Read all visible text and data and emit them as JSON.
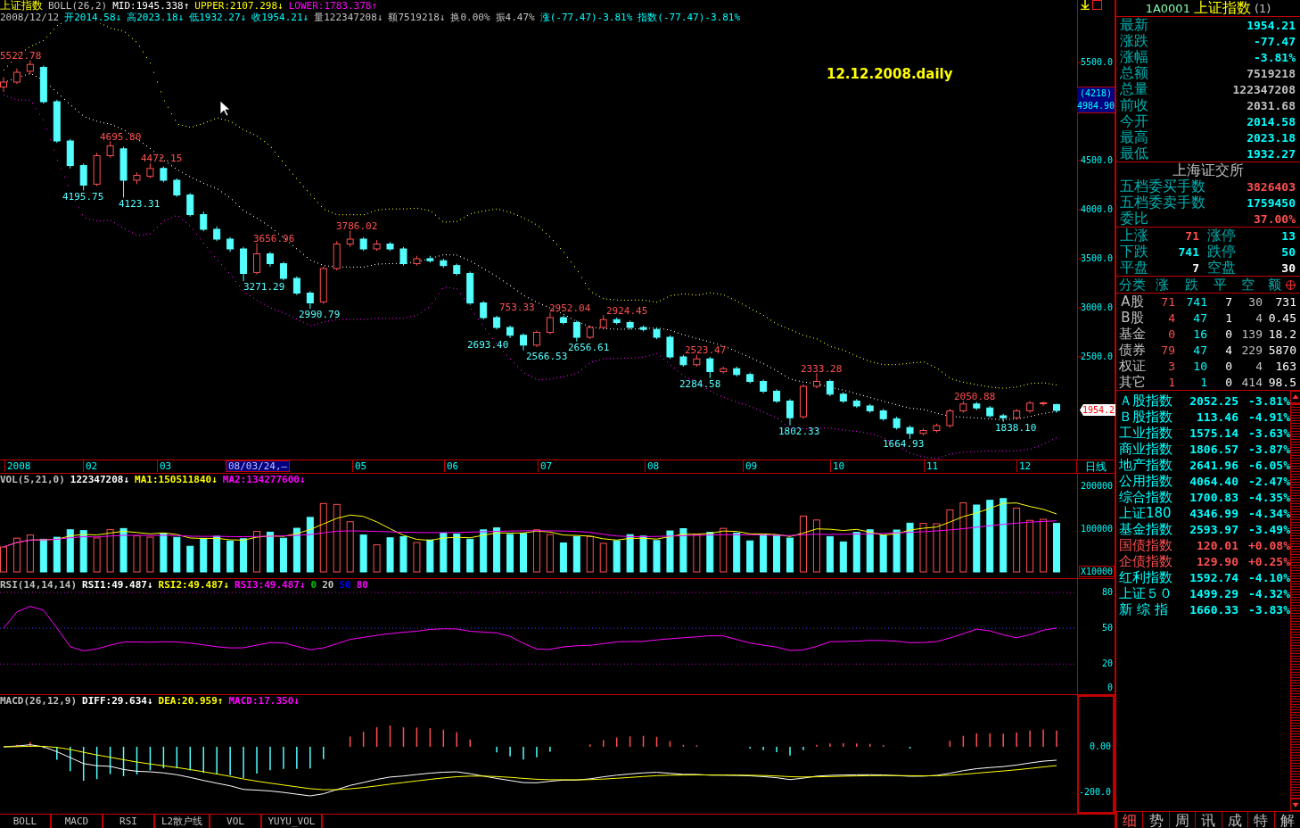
{
  "chart_header": {
    "title": "上证指数",
    "indicators": [
      {
        "text": "BOLL(26,2)",
        "color": "#c0c0c0"
      },
      {
        "text": "MID:1945.338↑",
        "color": "#ffffff"
      },
      {
        "text": "UPPER:2107.298↓",
        "color": "#ffff00"
      },
      {
        "text": "LOWER:1783.378↑",
        "color": "#ff00ff"
      }
    ]
  },
  "quote_line": [
    {
      "text": "2008/12/12",
      "color": "#c0c0c0"
    },
    {
      "text": "开2014.58↓",
      "color": "#00ffff"
    },
    {
      "text": "高2023.18↓",
      "color": "#00ffff"
    },
    {
      "text": "低1932.27↓",
      "color": "#00ffff"
    },
    {
      "text": "收1954.21↓",
      "color": "#00ffff"
    },
    {
      "text": "量122347208↓",
      "color": "#c0c0c0"
    },
    {
      "text": "额7519218↓",
      "color": "#c0c0c0"
    },
    {
      "text": "换0.00%",
      "color": "#c0c0c0"
    },
    {
      "text": "振4.47%",
      "color": "#c0c0c0"
    },
    {
      "text": "涨(-77.47)-3.81%",
      "color": "#00ffff"
    },
    {
      "text": "指数(-77.47)-3.81%",
      "color": "#00ffff"
    }
  ],
  "annotation": "12.12.2008.daily",
  "high_labels": [
    "5522.78",
    "4695.80",
    "4472.15",
    "3656.96",
    "3786.02",
    "753.33",
    "2952.04",
    "2924.45",
    "2523.47",
    "2333.28",
    "2050.88"
  ],
  "low_labels": [
    "4195.75",
    "4123.31",
    "3271.29",
    "2990.79",
    "2693.40",
    "2566.53",
    "2656.61",
    "2284.58",
    "1802.33",
    "1664.93",
    "1838.10"
  ],
  "chart_data": {
    "type": "candlestick",
    "ylim": [
      1454.5,
      6136.4
    ],
    "ohlc": [
      [
        5250,
        5350,
        5200,
        5300
      ],
      [
        5300,
        5440,
        5280,
        5400
      ],
      [
        5410,
        5522.78,
        5380,
        5480
      ],
      [
        5450,
        5470,
        5080,
        5100
      ],
      [
        5100,
        5120,
        4680,
        4700
      ],
      [
        4700,
        4720,
        4420,
        4450
      ],
      [
        4450,
        4470,
        4195.75,
        4250
      ],
      [
        4260,
        4580,
        4240,
        4550
      ],
      [
        4550,
        4695.8,
        4530,
        4650
      ],
      [
        4620,
        4640,
        4123.31,
        4300
      ],
      [
        4300,
        4380,
        4260,
        4350
      ],
      [
        4340,
        4472.15,
        4320,
        4420
      ],
      [
        4420,
        4440,
        4280,
        4300
      ],
      [
        4300,
        4320,
        4130,
        4150
      ],
      [
        4150,
        4170,
        3930,
        3950
      ],
      [
        3950,
        3980,
        3780,
        3800
      ],
      [
        3800,
        3830,
        3680,
        3700
      ],
      [
        3700,
        3720,
        3570,
        3600
      ],
      [
        3600,
        3620,
        3271.29,
        3350
      ],
      [
        3360,
        3656.96,
        3340,
        3550
      ],
      [
        3550,
        3570,
        3420,
        3450
      ],
      [
        3450,
        3470,
        3280,
        3300
      ],
      [
        3300,
        3320,
        3130,
        3150
      ],
      [
        3150,
        3170,
        2990.79,
        3050
      ],
      [
        3060,
        3420,
        3040,
        3400
      ],
      [
        3400,
        3680,
        3380,
        3650
      ],
      [
        3650,
        3786.02,
        3620,
        3700
      ],
      [
        3700,
        3720,
        3580,
        3600
      ],
      [
        3600,
        3690,
        3580,
        3650
      ],
      [
        3650,
        3670,
        3580,
        3600
      ],
      [
        3600,
        3620,
        3430,
        3450
      ],
      [
        3450,
        3530,
        3430,
        3500
      ],
      [
        3500,
        3530,
        3460,
        3480
      ],
      [
        3480,
        3500,
        3410,
        3430
      ],
      [
        3430,
        3450,
        3330,
        3350
      ],
      [
        3350,
        3370,
        3030,
        3050
      ],
      [
        3050,
        3070,
        2880,
        2900
      ],
      [
        2900,
        2920,
        2780,
        2800
      ],
      [
        2800,
        2820,
        2693.4,
        2720
      ],
      [
        2720,
        2740,
        2566.53,
        2620
      ],
      [
        2620,
        2770,
        2600,
        2750
      ],
      [
        2750,
        2952.04,
        2730,
        2900
      ],
      [
        2900,
        2920,
        2830,
        2850
      ],
      [
        2850,
        2870,
        2656.61,
        2700
      ],
      [
        2700,
        2820,
        2680,
        2800
      ],
      [
        2800,
        2924.45,
        2780,
        2880
      ],
      [
        2880,
        2900,
        2830,
        2850
      ],
      [
        2850,
        2870,
        2780,
        2800
      ],
      [
        2800,
        2820,
        2760,
        2780
      ],
      [
        2780,
        2800,
        2680,
        2700
      ],
      [
        2700,
        2720,
        2480,
        2500
      ],
      [
        2500,
        2520,
        2400,
        2420
      ],
      [
        2420,
        2523.47,
        2400,
        2480
      ],
      [
        2480,
        2500,
        2284.58,
        2350
      ],
      [
        2350,
        2400,
        2330,
        2380
      ],
      [
        2380,
        2400,
        2300,
        2320
      ],
      [
        2320,
        2340,
        2230,
        2250
      ],
      [
        2250,
        2270,
        2130,
        2150
      ],
      [
        2150,
        2170,
        2030,
        2050
      ],
      [
        2050,
        2070,
        1802.33,
        1880
      ],
      [
        1890,
        2220,
        1870,
        2200
      ],
      [
        2200,
        2333.28,
        2180,
        2250
      ],
      [
        2250,
        2270,
        2100,
        2120
      ],
      [
        2120,
        2140,
        2030,
        2050
      ],
      [
        2050,
        2070,
        1980,
        2000
      ],
      [
        2000,
        2020,
        1930,
        1950
      ],
      [
        1950,
        1970,
        1850,
        1870
      ],
      [
        1870,
        1890,
        1760,
        1780
      ],
      [
        1780,
        1800,
        1664.93,
        1720
      ],
      [
        1720,
        1770,
        1700,
        1750
      ],
      [
        1750,
        1820,
        1730,
        1800
      ],
      [
        1800,
        1970,
        1780,
        1950
      ],
      [
        1950,
        2050.88,
        1930,
        2020
      ],
      [
        2020,
        2040,
        1960,
        1980
      ],
      [
        1980,
        2000,
        1880,
        1900
      ],
      [
        1900,
        1920,
        1838.1,
        1880
      ],
      [
        1880,
        1970,
        1860,
        1950
      ],
      [
        1950,
        2050,
        1930,
        2030
      ],
      [
        2030,
        2045,
        2000,
        2031.68
      ],
      [
        2014.58,
        2023.18,
        1932.27,
        1954.21
      ]
    ],
    "yticks": [
      {
        "value": 5500,
        "label": "5500.0"
      },
      {
        "value": 4500,
        "label": "4500.0"
      },
      {
        "value": 4000,
        "label": "4000.0"
      },
      {
        "value": 3500,
        "label": "3500.0"
      },
      {
        "value": 3000,
        "label": "3000.0"
      },
      {
        "value": 2500,
        "label": "2500.0"
      }
    ]
  },
  "crosshair_tag": {
    "count": "(4218)",
    "price": "4984.90"
  },
  "last_price_tag": "1954.2",
  "time_axis": {
    "labels": [
      {
        "text": "2008",
        "selected": false
      },
      {
        "text": "02",
        "selected": false
      },
      {
        "text": "03",
        "selected": false
      },
      {
        "text": "08/03/24,—",
        "selected": true
      },
      {
        "text": "05",
        "selected": false
      },
      {
        "text": "06",
        "selected": false
      },
      {
        "text": "07",
        "selected": false
      },
      {
        "text": "08",
        "selected": false
      },
      {
        "text": "09",
        "selected": false
      },
      {
        "text": "10",
        "selected": false
      },
      {
        "text": "11",
        "selected": false
      },
      {
        "text": "12",
        "selected": false
      }
    ],
    "period": "日线"
  },
  "volume": {
    "indicators": [
      {
        "text": "VOL(5,21,0)",
        "color": "#c0c0c0"
      },
      {
        "text": "122347208↓",
        "color": "#ffffff"
      },
      {
        "text": "MA1:150511840↓",
        "color": "#ffff00"
      },
      {
        "text": "MA2:134277600↓",
        "color": "#ff00ff"
      }
    ],
    "axis": [
      "200000",
      "100000"
    ],
    "unit": "X10000"
  },
  "rsi": {
    "indicators": [
      {
        "text": "RSI(14,14,14)",
        "color": "#c0c0c0"
      },
      {
        "text": "RSI1:49.487↓",
        "color": "#ffffff"
      },
      {
        "text": "RSI2:49.487↓",
        "color": "#ffff00"
      },
      {
        "text": "RSI3:49.487↓",
        "color": "#ff00ff"
      },
      {
        "text": "0",
        "color": "#00c000"
      },
      {
        "text": "20",
        "color": "#c0c0c0"
      },
      {
        "text": "50",
        "color": "#0000ff"
      },
      {
        "text": "80",
        "color": "#ff00ff"
      }
    ],
    "axis": [
      "80",
      "50",
      "20",
      "0"
    ]
  },
  "macd": {
    "indicators": [
      {
        "text": "MACD(26,12,9)",
        "color": "#c0c0c0"
      },
      {
        "text": "DIFF:29.634↓",
        "color": "#ffffff"
      },
      {
        "text": "DEA:20.959↑",
        "color": "#ffff00"
      },
      {
        "text": "MACD:17.350↓",
        "color": "#ff00ff"
      }
    ],
    "axis": [
      "0.00",
      "-200.0"
    ]
  },
  "indicator_tabs": [
    {
      "label": "BOLL",
      "selected": false
    },
    {
      "label": "MACD",
      "selected": false
    },
    {
      "label": "RSI",
      "selected": false
    },
    {
      "label": "L2散户线",
      "selected": false
    },
    {
      "label": "VOL",
      "selected": false
    },
    {
      "label": "YUYU_VOL",
      "selected": false
    }
  ],
  "panel": {
    "code": "1A0001",
    "name": "上证指数",
    "suffix": "(1)",
    "quotes": [
      {
        "label": "最新",
        "value": "1954.21",
        "color": "#00ffff"
      },
      {
        "label": "涨跌",
        "value": "-77.47",
        "color": "#00ffff"
      },
      {
        "label": "涨幅",
        "value": "-3.81%",
        "color": "#00ffff"
      },
      {
        "label": "总额",
        "value": "7519218",
        "color": "#c0c0c0"
      },
      {
        "label": "总量",
        "value": "122347208",
        "color": "#c0c0c0"
      },
      {
        "label": "前收",
        "value": "2031.68",
        "color": "#c0c0c0"
      },
      {
        "label": "今开",
        "value": "2014.58",
        "color": "#00ffff"
      },
      {
        "label": "最高",
        "value": "2023.18",
        "color": "#00ffff"
      },
      {
        "label": "最低",
        "value": "1932.27",
        "color": "#00ffff"
      }
    ],
    "exchange": "上海证交所",
    "orders": [
      {
        "label": "五档委买手数",
        "value": "3826403",
        "color": "#ff5050"
      },
      {
        "label": "五档委卖手数",
        "value": "1759450",
        "color": "#00ffff"
      },
      {
        "label": "委比",
        "value": "37.00%",
        "color": "#ff5050"
      }
    ],
    "breadth": [
      {
        "label": "上涨",
        "value": "71",
        "color": "#ff5050"
      },
      {
        "label": "涨停",
        "value": "13",
        "color": "#00ffff"
      },
      {
        "label": "下跌",
        "value": "741",
        "color": "#00ffff"
      },
      {
        "label": "跌停",
        "value": "50",
        "color": "#00ffff"
      },
      {
        "label": "平盘",
        "value": "7",
        "color": "#ffffff"
      },
      {
        "label": "空盘",
        "value": "30",
        "color": "#ffffff"
      }
    ],
    "table": {
      "columns": [
        "分类",
        "涨",
        "跌",
        "平",
        "空",
        "额"
      ],
      "rows": [
        [
          "A股",
          "71",
          "741",
          "7",
          "30",
          "731"
        ],
        [
          "B股",
          "4",
          "47",
          "1",
          "4",
          "0.45"
        ],
        [
          "基金",
          "0",
          "16",
          "0",
          "139",
          "18.2"
        ],
        [
          "债券",
          "79",
          "47",
          "4",
          "229",
          "5870"
        ],
        [
          "权证",
          "3",
          "10",
          "0",
          "4",
          "163"
        ],
        [
          "其它",
          "1",
          "1",
          "0",
          "414",
          "98.5"
        ]
      ]
    },
    "indices": [
      {
        "name": "Ａ股指数",
        "value": "2052.25",
        "change": "-3.81%",
        "color": "#00ffff"
      },
      {
        "name": "Ｂ股指数",
        "value": "113.46",
        "change": "-4.91%",
        "color": "#00ffff"
      },
      {
        "name": "工业指数",
        "value": "1575.14",
        "change": "-3.63%",
        "color": "#00ffff"
      },
      {
        "name": "商业指数",
        "value": "1806.57",
        "change": "-3.87%",
        "color": "#00ffff"
      },
      {
        "name": "地产指数",
        "value": "2641.96",
        "change": "-6.05%",
        "color": "#00ffff"
      },
      {
        "name": "公用指数",
        "value": "4064.40",
        "change": "-2.47%",
        "color": "#00ffff"
      },
      {
        "name": "综合指数",
        "value": "1700.83",
        "change": "-4.35%",
        "color": "#00ffff"
      },
      {
        "name": "上证180",
        "value": "4346.99",
        "change": "-4.34%",
        "color": "#00ffff"
      },
      {
        "name": "基金指数",
        "value": "2593.97",
        "change": "-3.49%",
        "color": "#00ffff"
      },
      {
        "name": "国债指数",
        "value": "120.01",
        "change": "+0.08%",
        "color": "#ff5050"
      },
      {
        "name": "企债指数",
        "value": "129.90",
        "change": "+0.25%",
        "color": "#ff5050"
      },
      {
        "name": "红利指数",
        "value": "1592.74",
        "change": "-4.10%",
        "color": "#00ffff"
      },
      {
        "name": "上证５０",
        "value": "1499.29",
        "change": "-4.32%",
        "color": "#00ffff"
      },
      {
        "name": "新 综 指",
        "value": "1660.33",
        "change": "-3.83%",
        "color": "#00ffff"
      }
    ],
    "tabs": [
      {
        "label": "细",
        "selected": true
      },
      {
        "label": "势",
        "selected": false
      },
      {
        "label": "周",
        "selected": false
      },
      {
        "label": "讯",
        "selected": false
      },
      {
        "label": "成",
        "selected": false
      },
      {
        "label": "特",
        "selected": false
      },
      {
        "label": "解",
        "selected": false
      }
    ]
  }
}
